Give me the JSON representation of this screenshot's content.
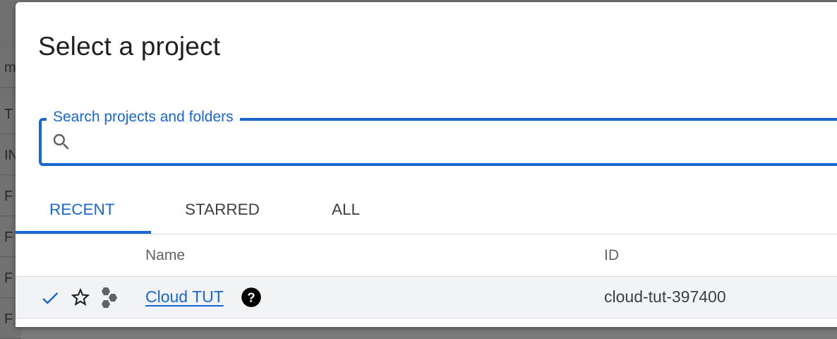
{
  "background": {
    "rows": [
      "m",
      "T",
      "IN",
      "F",
      "F",
      "F",
      "F"
    ]
  },
  "dialog": {
    "title": "Select a project"
  },
  "search": {
    "label": "Search projects and folders",
    "value": "",
    "icon": "search-icon"
  },
  "tabs": [
    {
      "label": "RECENT",
      "active": true
    },
    {
      "label": "STARRED",
      "active": false
    },
    {
      "label": "ALL",
      "active": false
    }
  ],
  "table": {
    "columns": {
      "name": "Name",
      "id": "ID"
    },
    "rows": [
      {
        "selected": true,
        "starred": false,
        "name": "Cloud TUT",
        "id": "cloud-tut-397400",
        "icons": [
          "check-icon",
          "star-outline-icon",
          "project-hexagons-icon",
          "help-icon"
        ]
      }
    ]
  },
  "colors": {
    "accent": "#1967d2",
    "text": "#202124",
    "muted": "#5f6368",
    "row_bg": "#f1f3f4"
  }
}
